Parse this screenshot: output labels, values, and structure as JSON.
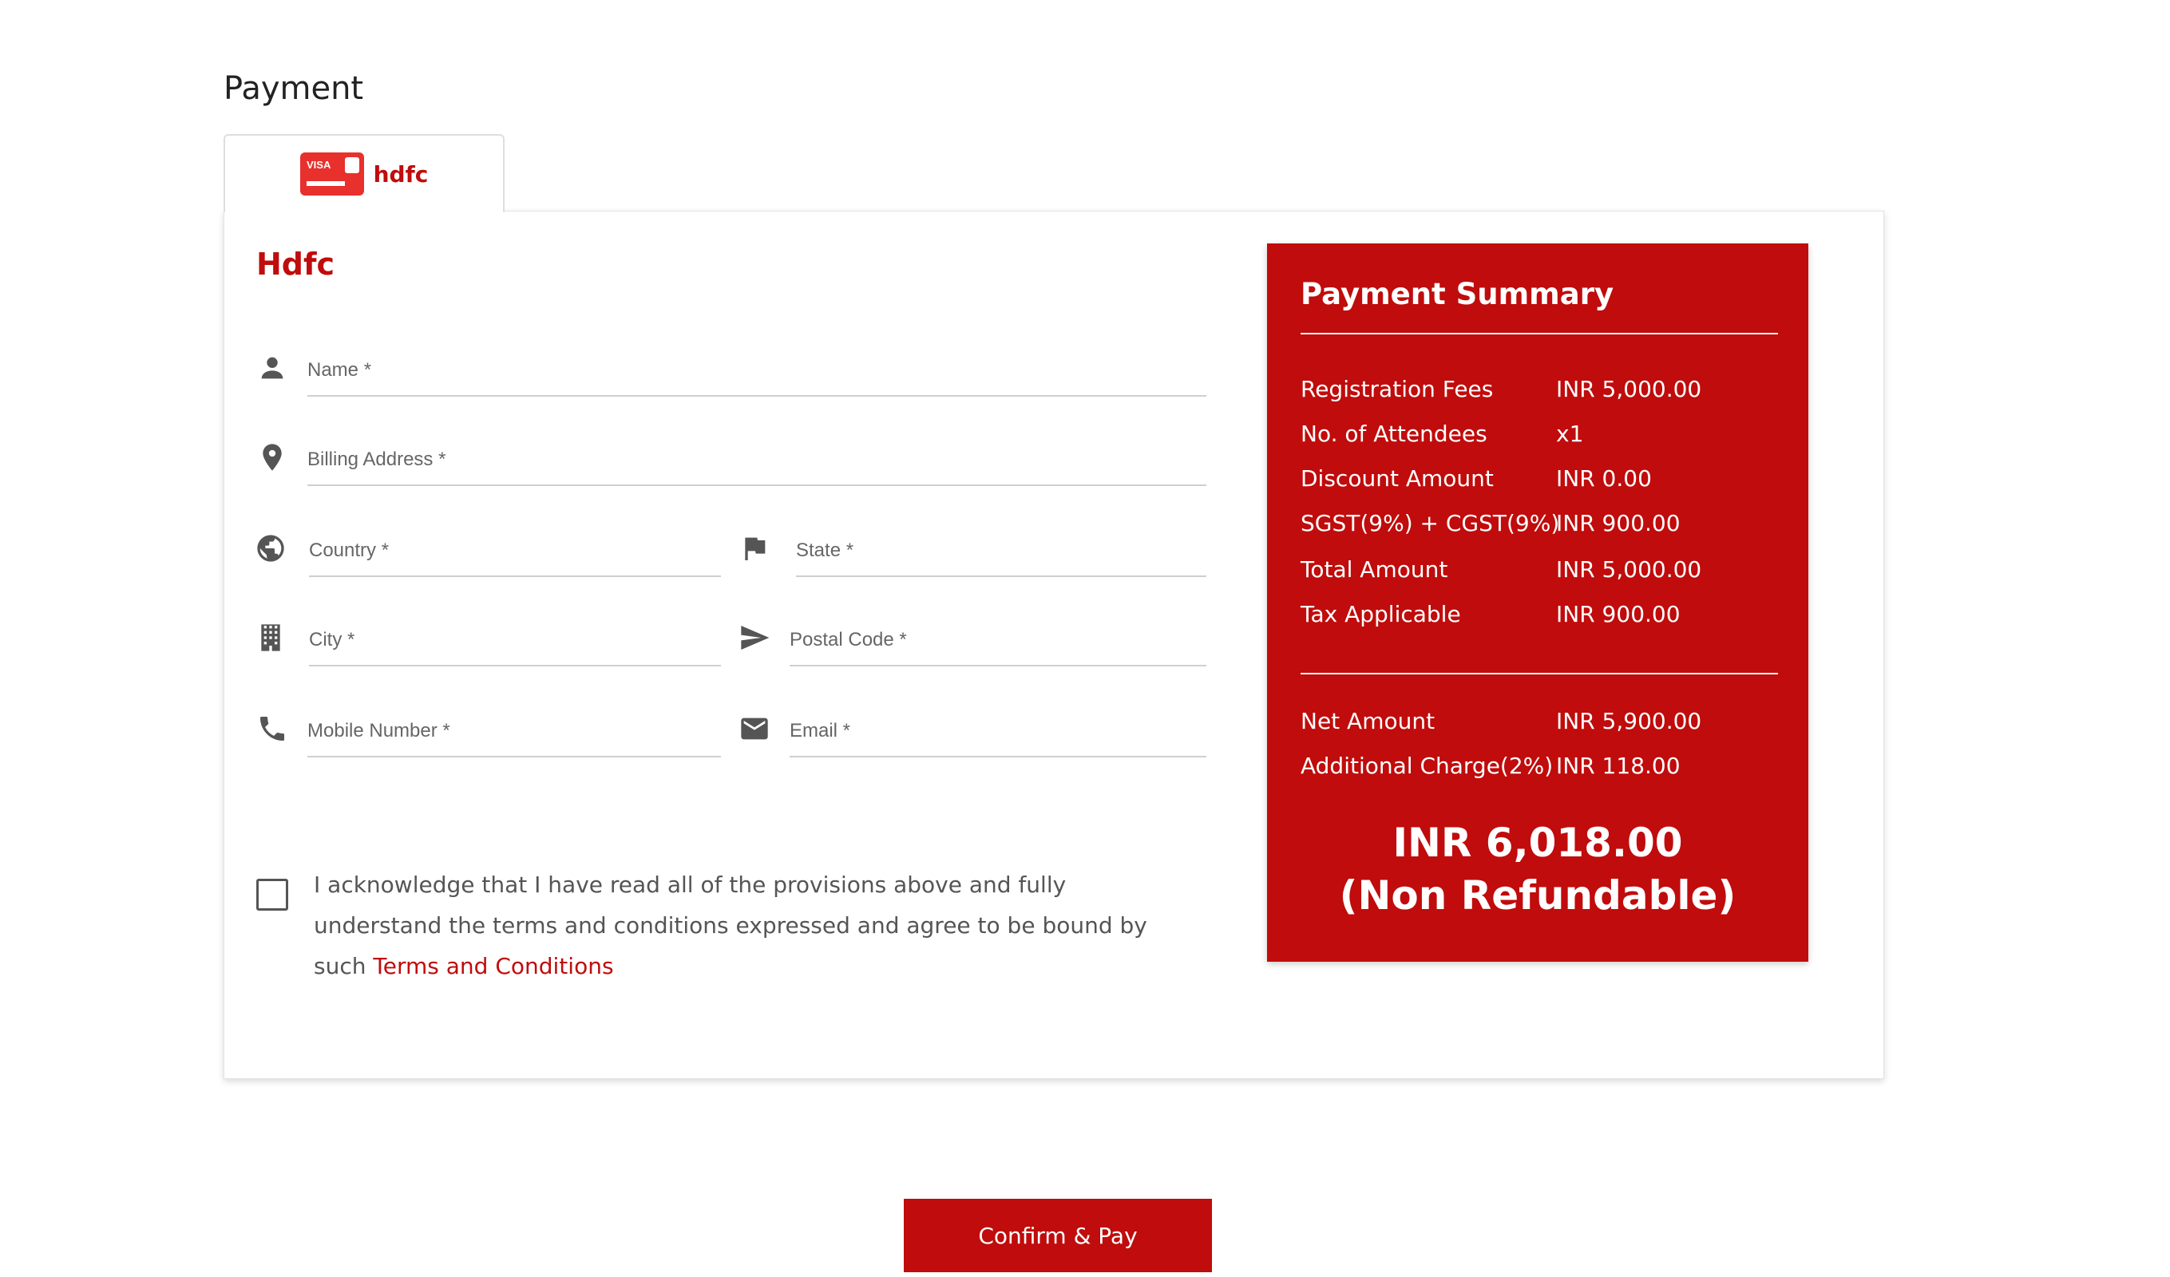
{
  "page": {
    "title": "Payment"
  },
  "tabs": [
    {
      "label": "hdfc",
      "icon": "visa-card-icon",
      "card_text": "VISA"
    }
  ],
  "form": {
    "title": "Hdfc",
    "fields": {
      "name": {
        "placeholder": "Name *",
        "icon": "person-icon"
      },
      "billing_address": {
        "placeholder": "Billing Address *",
        "icon": "location-pin-icon"
      },
      "country": {
        "placeholder": "Country *",
        "icon": "globe-icon"
      },
      "state": {
        "placeholder": "State *",
        "icon": "flag-icon"
      },
      "city": {
        "placeholder": "City *",
        "icon": "building-icon"
      },
      "postal_code": {
        "placeholder": "Postal Code *",
        "icon": "send-icon"
      },
      "mobile": {
        "placeholder": "Mobile Number *",
        "icon": "phone-icon"
      },
      "email": {
        "placeholder": "Email *",
        "icon": "mail-icon"
      }
    },
    "acknowledgement": {
      "text": "I acknowledge that I have read all of the provisions above and fully understand the terms and conditions expressed and agree to be bound by such",
      "link": "Terms and Conditions",
      "checked": false
    }
  },
  "summary": {
    "title": "Payment Summary",
    "rows": [
      {
        "label": "Registration Fees",
        "value": "INR 5,000.00"
      },
      {
        "label": "No. of Attendees",
        "value": "x1"
      },
      {
        "label": "Discount Amount",
        "value": "INR 0.00"
      },
      {
        "label": "SGST(9%) + CGST(9%)",
        "value": "INR 900.00"
      },
      {
        "label": "Total Amount",
        "value": "INR 5,000.00"
      },
      {
        "label": "Tax Applicable",
        "value": "INR 900.00"
      }
    ],
    "net_rows": [
      {
        "label": "Net Amount",
        "value": "INR 5,900.00"
      },
      {
        "label": "Additional Charge(2%)",
        "value": "INR 118.00"
      }
    ],
    "grand_total": "INR 6,018.00",
    "refund_note": "(Non Refundable)"
  },
  "actions": {
    "confirm_label": "Confirm & Pay"
  },
  "colors": {
    "accent": "#c00c0c",
    "text": "#555555",
    "border": "#cfcfcf"
  }
}
